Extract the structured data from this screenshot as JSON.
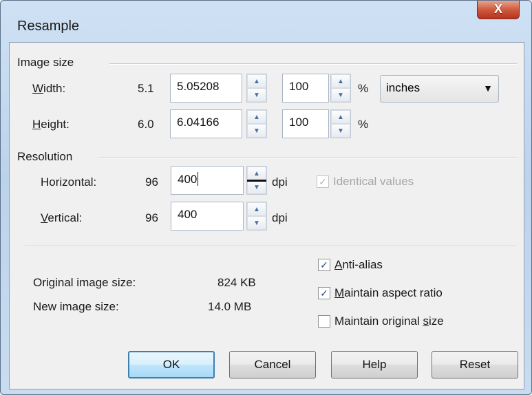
{
  "window": {
    "title": "Resample",
    "close_glyph": "X"
  },
  "image_size": {
    "section_label": "Image size",
    "width": {
      "label": "Width:",
      "original": "5.1",
      "value": "5.05208",
      "percent": "100",
      "percent_sign": "%"
    },
    "height": {
      "label": "Height:",
      "original": "6.0",
      "value": "6.04166",
      "percent": "100",
      "percent_sign": "%"
    },
    "units": {
      "selected": "inches"
    }
  },
  "resolution": {
    "section_label": "Resolution",
    "horizontal": {
      "label": "Horizontal:",
      "original": "96",
      "value": "400",
      "unit": "dpi"
    },
    "vertical": {
      "label": "Vertical:",
      "original": "96",
      "value": "400",
      "unit": "dpi"
    },
    "identical_values": {
      "label": "Identical values",
      "checked": true,
      "enabled": false
    }
  },
  "info": {
    "original_label": "Original image size:",
    "original_value": "824 KB",
    "new_label": "New image size:",
    "new_value": "14.0 MB"
  },
  "options": {
    "anti_alias": {
      "label": "Anti-alias",
      "checked": true
    },
    "maintain_aspect": {
      "label": "Maintain aspect ratio",
      "checked": true
    },
    "maintain_original": {
      "label": "Maintain original size",
      "checked": false
    }
  },
  "buttons": {
    "ok": "OK",
    "cancel": "Cancel",
    "help": "Help",
    "reset": "Reset"
  },
  "icons": {
    "spin_up": "▲",
    "spin_down": "▼",
    "combo_arrow": "▼",
    "check_mark": "✓"
  },
  "colors": {
    "title_gradient": "#bcd3ec",
    "close_button": "#c7472f",
    "default_button_border": "#3c7fb1"
  }
}
